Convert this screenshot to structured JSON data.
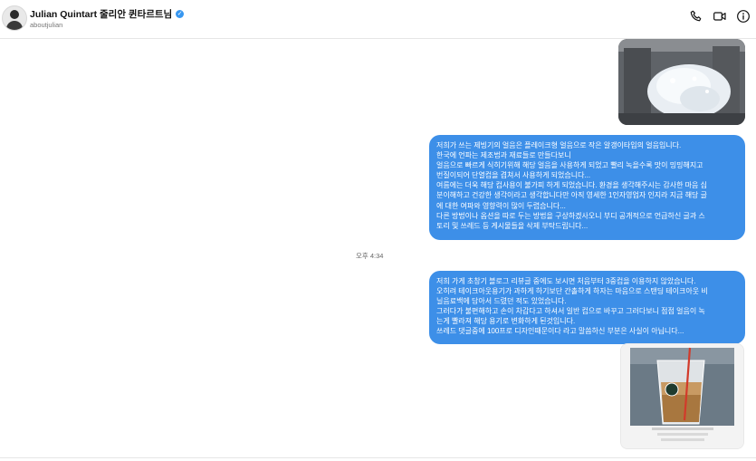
{
  "header": {
    "display_name": "Julian Quintart 줄리안 퀸타르트님",
    "username": "aboutjulian",
    "verified_icon": "verified-badge-icon",
    "actions": [
      {
        "icon": "phone-icon"
      },
      {
        "icon": "video-camera-icon"
      },
      {
        "icon": "info-icon"
      }
    ]
  },
  "messages": {
    "bubble1_lines": [
      "저희가 쓰는 제빙기의 얼음은 플레이크형 얼음으로 작은 알갱이타입의 얼음입니다.",
      "한국에 언파는 제조법과 재료들로 만들다보니",
      "얼음으로 빠르게 식히기위해 해당 얼음을 사용하게 되었고 빨리 녹을수록 맛이 밍밍해지고",
      "번질이되어 단열컵을 겹쳐서 사용하게 되었습니다...",
      "여름에는 더욱 해당 컵사용이 불가피 하게 되었습니다. 환경을 생각해주시는 감사한 마음 십",
      "분이해하고 건강한 생각이라고 생각합니다만 아직 영세한 1인자영업자 인지라 지금 해당 글",
      "에 대한 여파와 영향력이 많이 두렵습니다...",
      "다른 방법이나 옵션을 따로 두는 방법을 구상하겠사오니 부디 공개적으로 언급하신 글과 스",
      "토리 및 쓰레드 등 게시물들을 삭제 부탁드립니다..."
    ],
    "timestamp": "오후 4:34",
    "bubble2_lines": [
      "저희 가게 초창기 블로그 리뷰글 중에도 보시면 처음부터 3중컵을 이용하지 않았습니다.",
      "오히려 테이크아웃용기가 과하게 하기보단 간촐하게 하자는 마음으로 스탠딩 테이크아웃 비",
      "닐음료백에 담아서 드렸던 적도 있었습니다.",
      "그러다가 불편해하고 손이 차갑다고 하셔서 일반 컵으로 바꾸고 그러다보니 점점 얼음이 녹",
      "는게 빨라져 해당 용기로 변화하게 된것입니다.",
      "쓰레드 댓글중에 100프로 디자인때문이다 라고 말씀하신 부분은 사실이 아닙니다..."
    ]
  },
  "images": {
    "top_photo": "flake-ice-photo",
    "bottom_photo": "iced-drink-cup-photo"
  },
  "colors": {
    "bubble": "#3d8fe8",
    "verified": "#3897f0"
  }
}
